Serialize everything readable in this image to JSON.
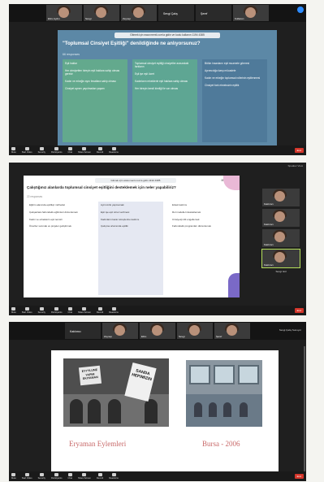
{
  "panel1": {
    "tiles": [
      "Ebru Aydın",
      "Sevgi",
      "Zeynep",
      "Sevgi Çalış",
      "Şeref",
      "Kullanıcı"
    ],
    "slide": {
      "url_bar": "Gitmek için www.menti.com'a gidin ve kodu kullanın 1194 4385",
      "question": "\"Toplumsal Cinsiyet Eşitliği\" denildiğinde ne anlıyorsunuz?",
      "responses": "66 responses",
      "col1": [
        "Eşit haklar",
        "Her cinsiyetten bireyin eşit haklara sahip olması gerekir",
        "Kadın ve erkeğin aynı fırsatlara sahip olması",
        "Cinsiyet ayrımı yapılmadan yaşam"
      ],
      "col2": [
        "Toplumsal cinsiyet eşitliği cinsiyetler arasındaki farkların",
        "Eşit işe eşit ücret",
        "Kadınların erkeklerle eşit haklara sahip olması",
        "Her bireyin kendi kimliği ile var olması"
      ],
      "col3": [
        "Bütün insanların eşit muamele görmesi",
        "Ayrımcılığa karşı mücadele",
        "Kadın ve erkeğin toplumsal rollerinin eşitlenmesi",
        "Cinsiyet fark etmeksizin eşitlik"
      ]
    },
    "controls": [
      "Mute",
      "Start Video",
      "Security",
      "Participants",
      "Chat",
      "Share Screen",
      "Record",
      "Reactions"
    ],
    "end": "End"
  },
  "panel2": {
    "header": "Speaker View",
    "slide": {
      "url_bar": "Gitmek için www.menti.com'a gidin 1194 4385",
      "brand": "Mentimeter",
      "question": "Çalıştığınız alanlarda toplumsal cinsiyet eşitliğini desteklemek için neler yapabiliriz?",
      "responses": "22 responses",
      "col1": [
        "Eğitim alanında eşitlikçi müfredat",
        "Çalışanlara farkındalık eğitimleri düzenlemek",
        "Kadın ve erkeklerin eşit temsili",
        "Öneriler sunmak ve projeler geliştirmek"
      ],
      "col2": [
        "Ayrımcılık yapmamak",
        "Eşit işe eşit ücret verilmesi",
        "Kadınların karar süreçlerine katılımı",
        "Çalışma ortamında eşitlik"
      ],
      "col3": [
        "Erkek katılımı",
        "Rol modelleri desteklemek",
        "Cinsiyetçi dili engellemek",
        "Farkındalık programları düzenlemek"
      ]
    },
    "side_names": [
      "Katılımcı",
      "Katılımcı",
      "Katılımcı",
      "Katılımcı"
    ],
    "selected_name": "Sevgi Gül",
    "controls": [
      "Mute",
      "Start Video",
      "Security",
      "Participants",
      "Chat",
      "Share Screen",
      "Record",
      "Reactions"
    ],
    "end": "End"
  },
  "panel3": {
    "header": "Sevgi Çalış Sunuyor",
    "tiles": [
      "Katılımcı",
      "Zeynep",
      "Ebru",
      "Sevgi",
      "Şeref"
    ],
    "sign1": "EYYYLUNE YAPIM EKIYAMAN",
    "sign2": "SANDA HEPIMIZIN",
    "caption1": "Eryaman Eylemleri",
    "caption2": "Bursa - 2006",
    "controls": [
      "Mute",
      "Start Video",
      "Security",
      "Participants",
      "Chat",
      "Share Screen",
      "Record",
      "Reactions"
    ],
    "end": "End"
  }
}
